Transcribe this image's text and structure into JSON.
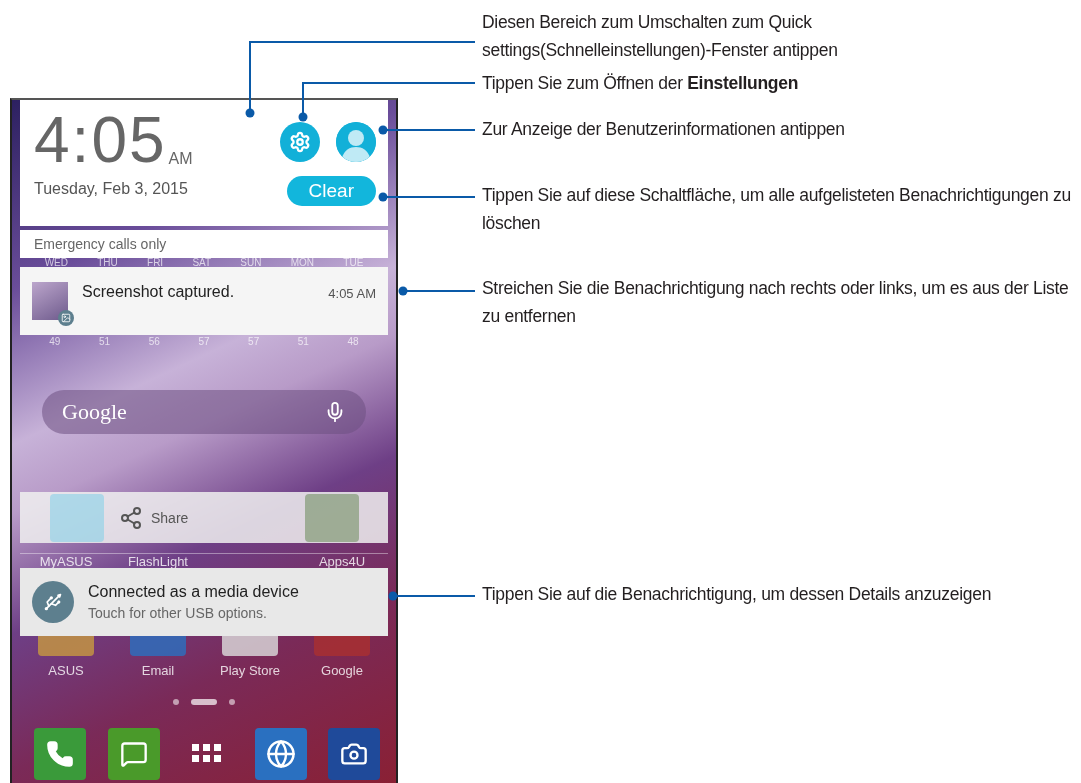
{
  "status_panel": {
    "time": "4:05",
    "meridiem": "AM",
    "date": "Tuesday, Feb 3, 2015",
    "clear_button": "Clear",
    "network_status": "Emergency calls only"
  },
  "weather": {
    "days": [
      "WED",
      "THU",
      "FRI",
      "SAT",
      "SUN",
      "MON",
      "TUE"
    ],
    "temperatures": [
      "49",
      "51",
      "56",
      "57",
      "57",
      "51",
      "48"
    ]
  },
  "screenshot_notification": {
    "title": "Screenshot captured.",
    "time": "4:05 AM"
  },
  "search_bar": {
    "logo_text": "Google"
  },
  "share_bar": {
    "label": "Share"
  },
  "app_labels_top": [
    {
      "kind": "app",
      "label": "MyASUS"
    },
    {
      "kind": "app",
      "label": "FlashLight"
    },
    {
      "kind": "folder",
      "label": "Apps4U"
    }
  ],
  "usb_notification": {
    "title": "Connected as a media device",
    "subtitle": "Touch for other USB options."
  },
  "app_labels_bottom": [
    "ASUS",
    "Email",
    "Play Store",
    "Google"
  ],
  "page_indicator": [
    {
      "selected": false
    },
    {
      "selected": true
    },
    {
      "selected": false
    }
  ],
  "callouts": [
    {
      "text": "Diesen Bereich zum Umschalten zum Quick settings(Schnelleinstellungen)-Fenster antippen"
    },
    {
      "text": "Tippen Sie zum Öffnen der **Einstellungen**"
    },
    {
      "text": "Zur Anzeige der Benutzerinformationen antippen"
    },
    {
      "text": "Tippen Sie auf diese Schaltfläche, um alle aufgelisteten Benachrichtigungen zu löschen"
    },
    {
      "text": "Streichen Sie die Benachrichtigung nach rechts oder links, um es aus der Liste zu entfernen"
    },
    {
      "text": "Tippen Sie auf die Benachrichtigung, um dessen Details anzuzeigen"
    }
  ]
}
